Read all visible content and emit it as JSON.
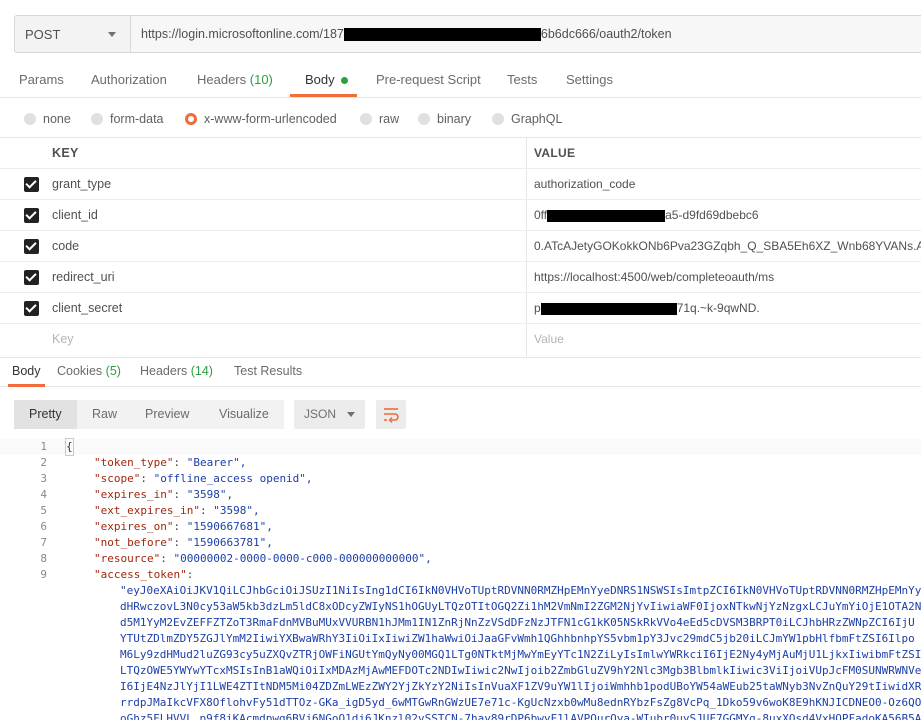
{
  "request": {
    "method": "POST",
    "url_prefix": "https://login.microsoftonline.com/187",
    "url_suffix": "6b6dc666/oauth2/token"
  },
  "request_tabs": [
    {
      "label": "Params"
    },
    {
      "label": "Authorization"
    },
    {
      "label": "Headers",
      "count": "(10)"
    },
    {
      "label": "Body"
    },
    {
      "label": "Pre-request Script"
    },
    {
      "label": "Tests"
    },
    {
      "label": "Settings"
    }
  ],
  "body_types": [
    "none",
    "form-data",
    "x-www-form-urlencoded",
    "raw",
    "binary",
    "GraphQL"
  ],
  "body_type_selected": "x-www-form-urlencoded",
  "params_table": {
    "key_header": "KEY",
    "value_header": "VALUE",
    "rows": [
      {
        "key": "grant_type",
        "value": "authorization_code"
      },
      {
        "key": "client_id",
        "value_prefix": "0ff",
        "value_suffix": "a5-d9fd69dbebc6"
      },
      {
        "key": "code",
        "value": "0.ATcAJetyGOKokkONb6Pva23GZqbh_Q_SBA5Eh6XZ_Wnb68YVANs.AC"
      },
      {
        "key": "redirect_uri",
        "value": "https://localhost:4500/web/completeoauth/ms"
      },
      {
        "key": "client_secret",
        "value_prefix": "p",
        "value_suffix": "71q.~k-9qwND."
      }
    ],
    "placeholder_key": "Key",
    "placeholder_value": "Value"
  },
  "response_tabs": [
    {
      "label": "Body"
    },
    {
      "label": "Cookies",
      "count": "(5)"
    },
    {
      "label": "Headers",
      "count": "(14)"
    },
    {
      "label": "Test Results"
    }
  ],
  "view_buttons": [
    "Pretty",
    "Raw",
    "Preview",
    "Visualize"
  ],
  "format": "JSON",
  "response_json": {
    "lines": [
      {
        "n": "1",
        "text": "{"
      },
      {
        "n": "2",
        "key": "\"token_type\"",
        "value": "\"Bearer\","
      },
      {
        "n": "3",
        "key": "\"scope\"",
        "value": "\"offline_access openid\","
      },
      {
        "n": "4",
        "key": "\"expires_in\"",
        "value": "\"3598\","
      },
      {
        "n": "5",
        "key": "\"ext_expires_in\"",
        "value": "\"3598\","
      },
      {
        "n": "6",
        "key": "\"expires_on\"",
        "value": "\"1590667681\","
      },
      {
        "n": "7",
        "key": "\"not_before\"",
        "value": "\"1590663781\","
      },
      {
        "n": "8",
        "key": "\"resource\"",
        "value": "\"00000002-0000-0000-c000-000000000000\","
      },
      {
        "n": "9",
        "key": "\"access_token\"",
        "value": ""
      }
    ],
    "access_token_lines": [
      "\"eyJ0eXAiOiJKV1QiLCJhbGciOiJSUzI1NiIsIng1dCI6IkN0VHVoTUptRDVNN0RMZHpEMnYyeDNRS1NSWSIsImtpZCI6IkN0VHVoTUptRDVNN0RMZHpEMnYye",
      "dHRwczovL3N0cy53aW5kb3dzLm5ldC8xODcyZWIyNS1hOGUyLTQzOTItOGQ2Zi1hM2VmNmI2ZGM2NjYvIiwiaWF0IjoxNTkwNjYzNzgxLCJuYmYiOjE1OTA2N",
      "d5M1YyM2EvZEFFZTZoT3RmaFdnMVBuMUxVVURBN1hJMm1IN1ZnRjNnZzVSdDFzNzJTFN1cG1kK05NSkRkVVo4eEd5cDVSM3BRPT0iLCJhbHRzZWNpZCI6IjU",
      "YTUtZDlmZDY5ZGJlYmM2IiwiYXBwaWRhY3IiOiIxIiwiZW1haWwiOiJaaGFvWmh1QGhhbnhpYS5vbm1pY3Jvc29mdC5jb20iLCJmYW1pbHlfbmFtZSI6Ilpo",
      "M6Ly9zdHMud2luZG93cy5uZXQvZTRjOWFiNGUtYmQyNy00MGQ1LTg0NTktMjMwYmEyYTc1N2ZiLyIsImlwYWRkciI6IjE2Ny4yMjAuMjU1LjkxIiwibmFtZSI6",
      "LTQzOWE5YWYwYTcxMSIsInB1aWQiOiIxMDAzMjAwMEFDOTc2NDIwIiwic2NwIjoib2ZmbGluZV9hY2Nlc3Mgb3BlbmlkIiwic3ViIjoiVUpJcFM0SUNWRWNVe",
      "I6IjE4NzJlYjI1LWE4ZTItNDM5Mi04ZDZmLWEzZWY2YjZkYzY2NiIsInVuaXF1ZV9uYW1lIjoiWmhhb1podUBoYW54aWEub25taWNyb3NvZnQuY29tIiwidXRp",
      "rrdpJMaIkcVFX8OflohvFy51dTTOz-GKa_igD5yd_6wMTGwRnGWzUE7e71c-KgUcNzxb0wMu8ednRYbzFsZg8VcPq_1Dko59v6woK8E9hKNJICDNEO0-Oz6QO7",
      "oGhz5FLHVVL p9f8iKAcmdpwg6BVj6NGoQ1dj6JKnzl02vSSTCN-7hay89rDP6bwyF1lAVPQurQya-WIubr0uySJUF7GGMYg-8uxXQsd4VxHOPFadoKA56B5A"
    ]
  }
}
